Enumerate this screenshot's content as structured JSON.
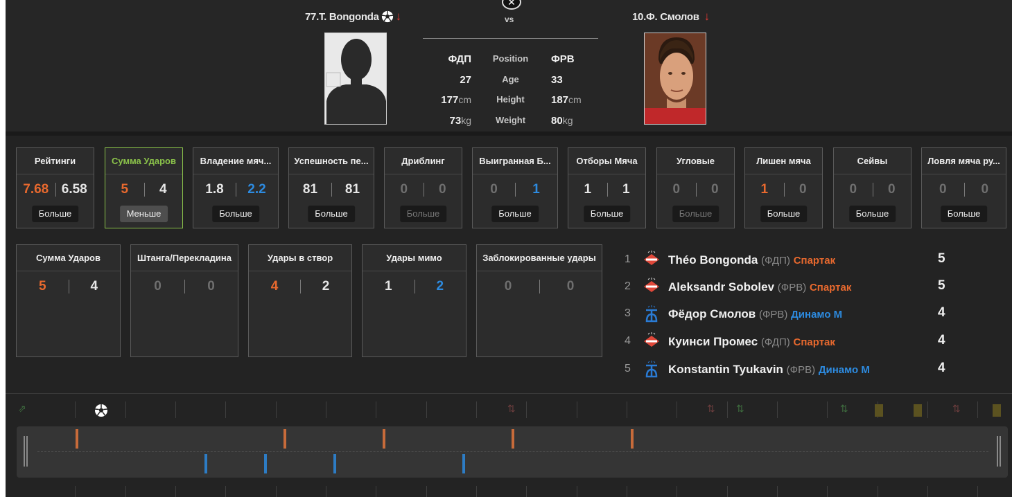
{
  "header": {
    "player1": {
      "name": "77.T. Bongonda",
      "position": "ФДП",
      "age": "27",
      "height": "177",
      "weight": "73"
    },
    "player2": {
      "name": "10.Ф. Смолов",
      "position": "ФРВ",
      "age": "33",
      "height": "187",
      "weight": "80"
    },
    "vs": "vs",
    "labels": {
      "position": "Position",
      "age": "Age",
      "height": "Height",
      "weight": "Weight",
      "cm": "cm",
      "kg": "kg"
    }
  },
  "stat_cards": [
    {
      "title": "Рейтинги",
      "v1": "7.68",
      "v2": "6.58",
      "button": "Больше"
    },
    {
      "title": "Сумма Ударов",
      "v1": "5",
      "v2": "4",
      "button": "Меньше"
    },
    {
      "title": "Владение мяч...",
      "v1": "1.8",
      "v2": "2.2",
      "button": "Больше"
    },
    {
      "title": "Успешность пе...",
      "v1": "81",
      "v2": "81",
      "button": "Больше"
    },
    {
      "title": "Дриблинг",
      "v1": "0",
      "v2": "0",
      "button": "Больше"
    },
    {
      "title": "Выигранная Б...",
      "v1": "0",
      "v2": "1",
      "button": "Больше"
    },
    {
      "title": "Отборы Мяча",
      "v1": "1",
      "v2": "1",
      "button": "Больше"
    },
    {
      "title": "Угловые",
      "v1": "0",
      "v2": "0",
      "button": "Больше"
    },
    {
      "title": "Лишен мяча",
      "v1": "1",
      "v2": "0",
      "button": "Больше"
    },
    {
      "title": "Сейвы",
      "v1": "0",
      "v2": "0",
      "button": "Больше"
    },
    {
      "title": "Ловля мяча ру...",
      "v1": "0",
      "v2": "0",
      "button": "Больше"
    }
  ],
  "shot_cards": [
    {
      "title": "Сумма Ударов",
      "v1": "5",
      "v2": "4"
    },
    {
      "title": "Штанга/Перекладина",
      "v1": "0",
      "v2": "0"
    },
    {
      "title": "Удары в створ",
      "v1": "4",
      "v2": "2"
    },
    {
      "title": "Удары мимо",
      "v1": "1",
      "v2": "2"
    },
    {
      "title": "Заблокированные удары",
      "v1": "0",
      "v2": "0"
    }
  ],
  "leaders": [
    {
      "rank": "1",
      "name": "Théo Bongonda",
      "pos": "(ФДП)",
      "team": "Спартак",
      "count": "5"
    },
    {
      "rank": "2",
      "name": "Aleksandr Sobolev",
      "pos": "(ФРВ)",
      "team": "Спартак",
      "count": "5"
    },
    {
      "rank": "3",
      "name": "Фёдор Смолов",
      "pos": "(ФРВ)",
      "team": "Динамо М",
      "count": "4"
    },
    {
      "rank": "4",
      "name": "Куинси Промес",
      "pos": "(ФДП)",
      "team": "Спартак",
      "count": "4"
    },
    {
      "rank": "5",
      "name": "Konstantin Tyukavin",
      "pos": "(ФРВ)",
      "team": "Динамо М",
      "count": "4"
    }
  ],
  "colors": {
    "orange": "#e8692e",
    "blue": "#2d8be0",
    "active_green": "#8bc34a",
    "bg": "#232323"
  },
  "icons": {
    "ball": "football-icon",
    "sub": "substitution-icon",
    "card": "yellow-card-icon",
    "grip": "drag-handle-icon",
    "close": "close-icon"
  }
}
